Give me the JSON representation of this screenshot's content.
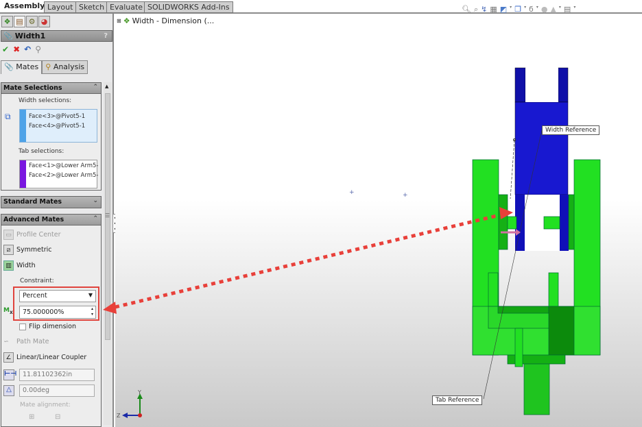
{
  "command_tabs": [
    "Assembly",
    "Layout",
    "Sketch",
    "Evaluate",
    "SOLIDWORKS Add-Ins"
  ],
  "manager_tabs": [
    {
      "icon": "feature-manager-icon"
    },
    {
      "icon": "property-manager-icon"
    },
    {
      "icon": "configuration-manager-icon"
    },
    {
      "icon": "display-manager-icon"
    }
  ],
  "property_manager": {
    "title": "Width1",
    "help": "?",
    "actions": [
      {
        "name": "ok",
        "glyph": "✔",
        "color": "#2e9e2e"
      },
      {
        "name": "cancel",
        "glyph": "✖",
        "color": "#d22"
      },
      {
        "name": "undo",
        "glyph": "↶",
        "color": "#2a5fb8"
      },
      {
        "name": "pushpin",
        "glyph": "⚲",
        "color": "#777"
      }
    ],
    "tabs": [
      "Mates",
      "Analysis"
    ],
    "mate_selections": {
      "header": "Mate Selections",
      "width_label": "Width selections:",
      "width_items": [
        "Face<3>@Pivot5-1",
        "Face<4>@Pivot5-1"
      ],
      "width_color": "#4ea3e8",
      "tab_label": "Tab selections:",
      "tab_items": [
        "Face<1>@Lower Arm5-",
        "Face<2>@Lower Arm5-"
      ],
      "tab_color": "#7a17e0"
    },
    "standard_mates": {
      "header": "Standard Mates"
    },
    "advanced_mates": {
      "header": "Advanced Mates",
      "profile_center": "Profile Center",
      "symmetric": "Symmetric",
      "width": "Width",
      "constraint_label": "Constraint:",
      "constraint_value": "Percent",
      "percent_value": "75.000000%",
      "flip_dimension": "Flip dimension",
      "flip_checked": false,
      "path_mate": "Path Mate",
      "linear_coupler": "Linear/Linear Coupler",
      "distance_value": "11.81102362in",
      "angle_value": "0.00deg",
      "mate_alignment": "Mate alignment:"
    }
  },
  "tree": {
    "item": "Width - Dimension  (..."
  },
  "viewport": {
    "callouts": {
      "width_reference": "Width Reference",
      "tab_reference": "Tab Reference"
    },
    "triad": {
      "y": "Y",
      "z": "Z"
    },
    "toolbar_icons": [
      "zoom-to-fit-icon",
      "zoom-to-area-icon",
      "previous-view-icon",
      "section-view-icon",
      "view-orientation-icon",
      "display-style-icon",
      "hide-show-icon",
      "edit-appearance-icon",
      "apply-scene-icon",
      "view-settings-icon"
    ],
    "colors": {
      "green": "#22e022",
      "blue": "#1a1ad6",
      "arrow": "#e8403a"
    }
  }
}
